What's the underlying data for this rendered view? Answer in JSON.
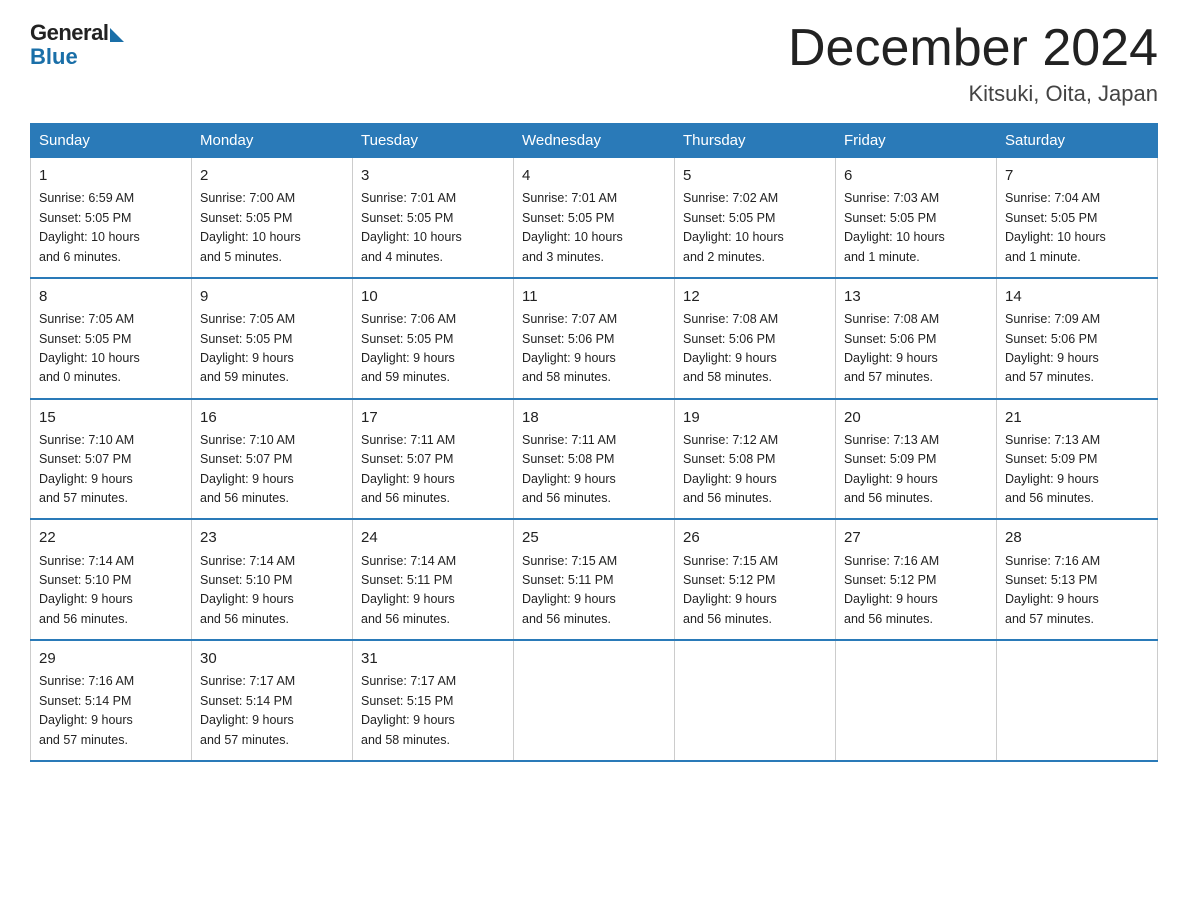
{
  "logo": {
    "general": "General",
    "blue": "Blue"
  },
  "header": {
    "month_year": "December 2024",
    "location": "Kitsuki, Oita, Japan"
  },
  "days_of_week": [
    "Sunday",
    "Monday",
    "Tuesday",
    "Wednesday",
    "Thursday",
    "Friday",
    "Saturday"
  ],
  "weeks": [
    [
      {
        "day": "1",
        "info": "Sunrise: 6:59 AM\nSunset: 5:05 PM\nDaylight: 10 hours\nand 6 minutes."
      },
      {
        "day": "2",
        "info": "Sunrise: 7:00 AM\nSunset: 5:05 PM\nDaylight: 10 hours\nand 5 minutes."
      },
      {
        "day": "3",
        "info": "Sunrise: 7:01 AM\nSunset: 5:05 PM\nDaylight: 10 hours\nand 4 minutes."
      },
      {
        "day": "4",
        "info": "Sunrise: 7:01 AM\nSunset: 5:05 PM\nDaylight: 10 hours\nand 3 minutes."
      },
      {
        "day": "5",
        "info": "Sunrise: 7:02 AM\nSunset: 5:05 PM\nDaylight: 10 hours\nand 2 minutes."
      },
      {
        "day": "6",
        "info": "Sunrise: 7:03 AM\nSunset: 5:05 PM\nDaylight: 10 hours\nand 1 minute."
      },
      {
        "day": "7",
        "info": "Sunrise: 7:04 AM\nSunset: 5:05 PM\nDaylight: 10 hours\nand 1 minute."
      }
    ],
    [
      {
        "day": "8",
        "info": "Sunrise: 7:05 AM\nSunset: 5:05 PM\nDaylight: 10 hours\nand 0 minutes."
      },
      {
        "day": "9",
        "info": "Sunrise: 7:05 AM\nSunset: 5:05 PM\nDaylight: 9 hours\nand 59 minutes."
      },
      {
        "day": "10",
        "info": "Sunrise: 7:06 AM\nSunset: 5:05 PM\nDaylight: 9 hours\nand 59 minutes."
      },
      {
        "day": "11",
        "info": "Sunrise: 7:07 AM\nSunset: 5:06 PM\nDaylight: 9 hours\nand 58 minutes."
      },
      {
        "day": "12",
        "info": "Sunrise: 7:08 AM\nSunset: 5:06 PM\nDaylight: 9 hours\nand 58 minutes."
      },
      {
        "day": "13",
        "info": "Sunrise: 7:08 AM\nSunset: 5:06 PM\nDaylight: 9 hours\nand 57 minutes."
      },
      {
        "day": "14",
        "info": "Sunrise: 7:09 AM\nSunset: 5:06 PM\nDaylight: 9 hours\nand 57 minutes."
      }
    ],
    [
      {
        "day": "15",
        "info": "Sunrise: 7:10 AM\nSunset: 5:07 PM\nDaylight: 9 hours\nand 57 minutes."
      },
      {
        "day": "16",
        "info": "Sunrise: 7:10 AM\nSunset: 5:07 PM\nDaylight: 9 hours\nand 56 minutes."
      },
      {
        "day": "17",
        "info": "Sunrise: 7:11 AM\nSunset: 5:07 PM\nDaylight: 9 hours\nand 56 minutes."
      },
      {
        "day": "18",
        "info": "Sunrise: 7:11 AM\nSunset: 5:08 PM\nDaylight: 9 hours\nand 56 minutes."
      },
      {
        "day": "19",
        "info": "Sunrise: 7:12 AM\nSunset: 5:08 PM\nDaylight: 9 hours\nand 56 minutes."
      },
      {
        "day": "20",
        "info": "Sunrise: 7:13 AM\nSunset: 5:09 PM\nDaylight: 9 hours\nand 56 minutes."
      },
      {
        "day": "21",
        "info": "Sunrise: 7:13 AM\nSunset: 5:09 PM\nDaylight: 9 hours\nand 56 minutes."
      }
    ],
    [
      {
        "day": "22",
        "info": "Sunrise: 7:14 AM\nSunset: 5:10 PM\nDaylight: 9 hours\nand 56 minutes."
      },
      {
        "day": "23",
        "info": "Sunrise: 7:14 AM\nSunset: 5:10 PM\nDaylight: 9 hours\nand 56 minutes."
      },
      {
        "day": "24",
        "info": "Sunrise: 7:14 AM\nSunset: 5:11 PM\nDaylight: 9 hours\nand 56 minutes."
      },
      {
        "day": "25",
        "info": "Sunrise: 7:15 AM\nSunset: 5:11 PM\nDaylight: 9 hours\nand 56 minutes."
      },
      {
        "day": "26",
        "info": "Sunrise: 7:15 AM\nSunset: 5:12 PM\nDaylight: 9 hours\nand 56 minutes."
      },
      {
        "day": "27",
        "info": "Sunrise: 7:16 AM\nSunset: 5:12 PM\nDaylight: 9 hours\nand 56 minutes."
      },
      {
        "day": "28",
        "info": "Sunrise: 7:16 AM\nSunset: 5:13 PM\nDaylight: 9 hours\nand 57 minutes."
      }
    ],
    [
      {
        "day": "29",
        "info": "Sunrise: 7:16 AM\nSunset: 5:14 PM\nDaylight: 9 hours\nand 57 minutes."
      },
      {
        "day": "30",
        "info": "Sunrise: 7:17 AM\nSunset: 5:14 PM\nDaylight: 9 hours\nand 57 minutes."
      },
      {
        "day": "31",
        "info": "Sunrise: 7:17 AM\nSunset: 5:15 PM\nDaylight: 9 hours\nand 58 minutes."
      },
      {
        "day": "",
        "info": ""
      },
      {
        "day": "",
        "info": ""
      },
      {
        "day": "",
        "info": ""
      },
      {
        "day": "",
        "info": ""
      }
    ]
  ]
}
